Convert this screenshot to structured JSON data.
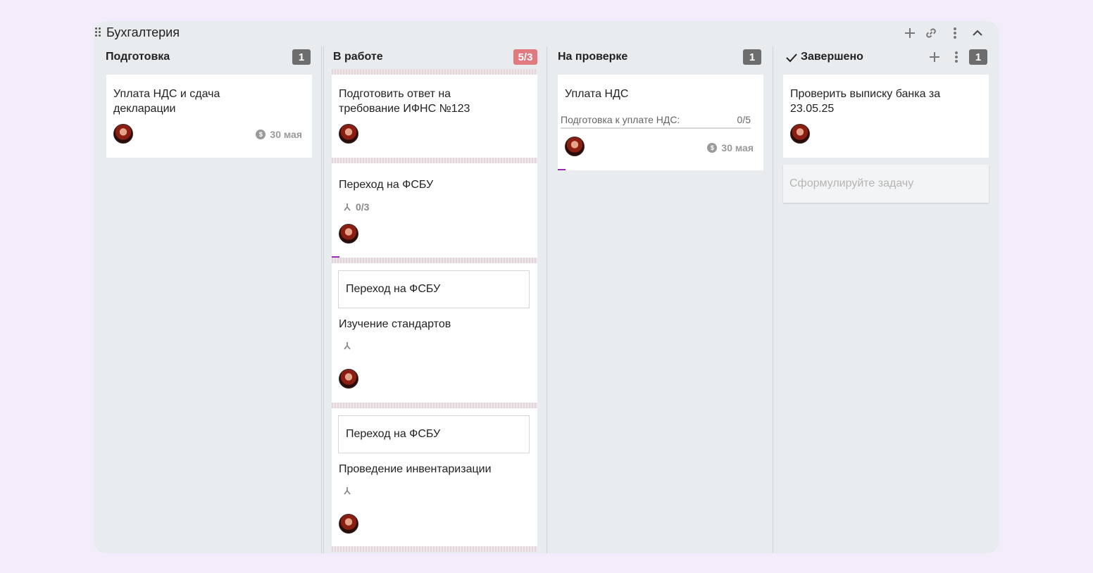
{
  "board": {
    "title": "Бухгалтерия",
    "accent_color": "#9c27b0"
  },
  "columns": [
    {
      "title": "Подготовка",
      "count": "1",
      "cards": [
        {
          "title": "Уплата НДС и сдача декларации",
          "date": "30 мая",
          "date_icon": "money-icon"
        }
      ]
    },
    {
      "title": "В работе",
      "count": "5/3",
      "cards": [
        {
          "title": "Подготовить ответ на требование ИФНС №123"
        },
        {
          "title": "Переход на ФСБУ",
          "subtasks": "0/3"
        },
        {
          "parent": "Переход на ФСБУ",
          "title": "Изучение стандартов"
        },
        {
          "parent": "Переход на ФСБУ",
          "title": "Проведение инвентаризации"
        }
      ]
    },
    {
      "title": "На проверке",
      "count": "1",
      "cards": [
        {
          "title": "Уплата НДС",
          "checklist_label": "Подготовка к уплате НДС:",
          "checklist_count": "0/5",
          "date": "30 мая"
        }
      ]
    },
    {
      "title": "Завершено",
      "count": "1",
      "cards": [
        {
          "title": "Проверить выписку банка за 23.05.25"
        }
      ],
      "new_task_placeholder": "Сформулируйте задачу"
    }
  ]
}
